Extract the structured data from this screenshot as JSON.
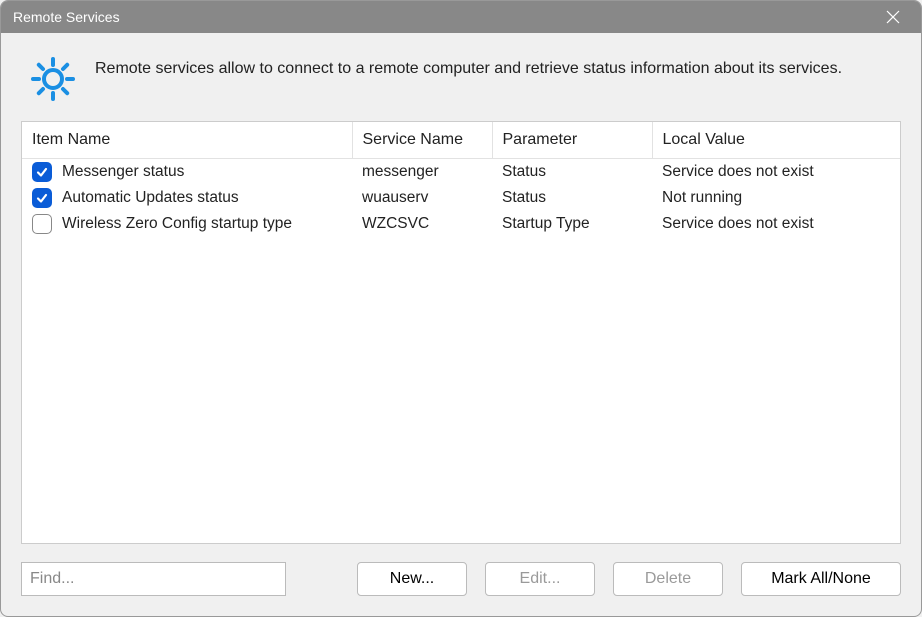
{
  "window": {
    "title": "Remote Services"
  },
  "header": {
    "description": "Remote services allow to connect to a remote computer and retrieve status information about its services."
  },
  "table": {
    "columns": {
      "item_name": "Item Name",
      "service_name": "Service Name",
      "parameter": "Parameter",
      "local_value": "Local Value"
    },
    "rows": [
      {
        "checked": true,
        "item_name": "Messenger status",
        "service_name": "messenger",
        "parameter": "Status",
        "local_value": "Service does not exist"
      },
      {
        "checked": true,
        "item_name": "Automatic Updates status",
        "service_name": "wuauserv",
        "parameter": "Status",
        "local_value": "Not running"
      },
      {
        "checked": false,
        "item_name": "Wireless Zero Config startup type",
        "service_name": "WZCSVC",
        "parameter": "Startup Type",
        "local_value": "Service does not exist"
      }
    ]
  },
  "footer": {
    "find_placeholder": "Find...",
    "new_label": "New...",
    "edit_label": "Edit...",
    "delete_label": "Delete",
    "mark_label": "Mark All/None"
  }
}
